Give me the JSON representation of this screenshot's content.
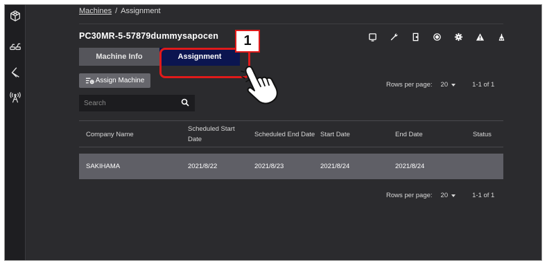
{
  "breadcrumb": {
    "parent": "Machines",
    "separator": "/",
    "current": "Assignment"
  },
  "machine": {
    "title": "PC30MR-5-57879dummysapocen"
  },
  "toolbar_icons": [
    "tablet-icon",
    "wrench-icon",
    "door-icon",
    "target-icon",
    "gear-icon",
    "warning-icon",
    "antenna-tower-icon"
  ],
  "rail_icons": [
    "cube-network-icon",
    "excavators-icon",
    "boom-arm-icon",
    "radio-tower-icon"
  ],
  "tabs": [
    {
      "label": "Machine Info",
      "active": false
    },
    {
      "label": "Assignment",
      "active": true
    }
  ],
  "callout": {
    "number": "1"
  },
  "assign_button": {
    "label": "Assign Machine"
  },
  "search": {
    "placeholder": "Search",
    "value": ""
  },
  "pagination_top": {
    "label": "Rows per page:",
    "rows": "20",
    "range": "1-1 of 1"
  },
  "pagination_bottom": {
    "label": "Rows per page:",
    "rows": "20",
    "range": "1-1 of 1"
  },
  "table": {
    "headers": [
      "Company Name",
      "Scheduled Start Date",
      "Scheduled End Date",
      "Start Date",
      "End Date",
      "Status"
    ],
    "rows": [
      [
        "SAKIHAMA",
        "2021/8/22",
        "2021/8/23",
        "2021/8/24",
        "2021/8/24",
        ""
      ]
    ]
  },
  "colors": {
    "background": "#2b2b2e",
    "active_tab": "#0b1550",
    "inactive_tab": "#55555b",
    "highlight": "#e01a1a",
    "row": "#5f5f66"
  }
}
